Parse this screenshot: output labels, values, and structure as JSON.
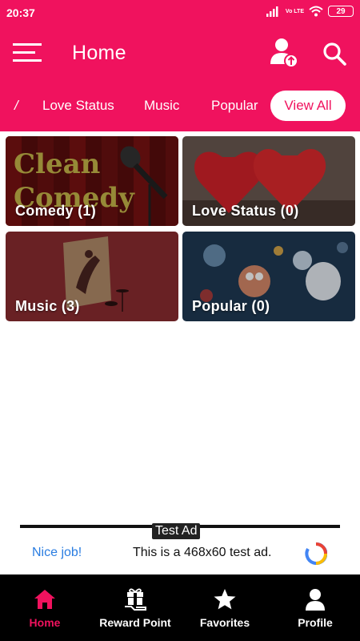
{
  "status_bar": {
    "time": "20:37",
    "network": "Vo LTE",
    "battery": "29"
  },
  "header": {
    "title": "Home"
  },
  "tabs": {
    "items": [
      "/",
      "Love Status",
      "Music",
      "Popular"
    ],
    "view_all": "View All"
  },
  "categories": [
    {
      "label": "Comedy (1)",
      "image_text": [
        "Clean",
        "Comedy"
      ]
    },
    {
      "label": "Love Status (0)"
    },
    {
      "label": "Music (3)"
    },
    {
      "label": "Popular (0)"
    }
  ],
  "ad": {
    "tag": "Test Ad",
    "headline": "Nice job!",
    "text": "This is a 468x60 test ad."
  },
  "bottom_nav": {
    "items": [
      {
        "label": "Home",
        "icon": "home-icon",
        "active": true
      },
      {
        "label": "Reward Point",
        "icon": "gift-icon",
        "active": false
      },
      {
        "label": "Favorites",
        "icon": "star-icon",
        "active": false
      },
      {
        "label": "Profile",
        "icon": "person-icon",
        "active": false
      }
    ]
  },
  "colors": {
    "primary": "#f0125e",
    "nav_bg": "#000000",
    "ad_link": "#2a7de1"
  }
}
